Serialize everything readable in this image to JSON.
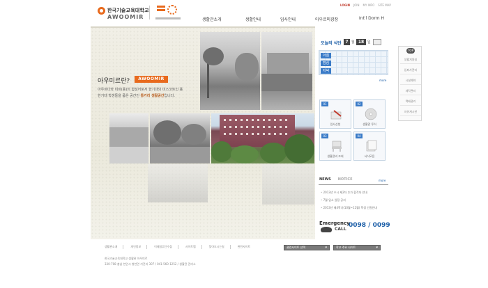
{
  "header": {
    "logo_name": "한국기술교육대학교",
    "logo_sub": "AWOOMIR",
    "top_links": [
      "LOGIN",
      "JOIN",
      "MY INFO",
      "SITE MAP"
    ],
    "gnb": [
      "생활관소개",
      "생활안내",
      "입사안내",
      "아우르미광장",
      "Int'l Dorm H"
    ]
  },
  "hero": {
    "title": "아우미르란?",
    "badge": "AWOOMIR",
    "desc_1": "아우르다와 미르(용)의 합성어로서 한기대의 미스코트인 용",
    "desc_2": "한기대 학생들을 품은 공간인 ",
    "desc_highlight": "통가리 생활공간",
    "desc_3": "입니다."
  },
  "today_meal": {
    "label": "오늘의 식단",
    "month": "7",
    "month_unit": "월",
    "day": "18",
    "day_unit": "일",
    "meals": [
      "아침",
      "점심",
      "저녁"
    ],
    "more": "more"
  },
  "quick_menu": [
    {
      "num": "01",
      "label": "입사신청"
    },
    {
      "num": "02",
      "label": "생활관 투어"
    },
    {
      "num": "03",
      "label": "생활관비 조회"
    },
    {
      "num": "04",
      "label": "서식모음"
    }
  ],
  "news": {
    "tab_news": "NEWS",
    "tab_notice": "NOTICE",
    "more": "more",
    "items": [
      "2013년 수시 제2차 추가 합격자 안내",
      "7월 입소 일정 공지",
      "2013년 제4학기(10월~12월) 학생 인원안내"
    ]
  },
  "emergency": {
    "label": "Emergency",
    "call": "CALL",
    "number": "0098 / 0099"
  },
  "sidebar": {
    "top": "TOP",
    "items": [
      "생활지원실",
      "입퇴사관리",
      "시설예약",
      "세탁관리",
      "택배관리",
      "자유게시판"
    ]
  },
  "footer": {
    "links": [
      "생활관소개",
      "개인정보",
      "이메일무단수집",
      "사이트맵",
      "찾아오시는길",
      "관련사이트"
    ],
    "select_1": "관련사이트 선택",
    "select_2": "학교 주요 사이트",
    "address_1": "한국기술교육대학교 생활관 아우미르",
    "address_2": "330-708 충남 천안시 병천면 가전리 307 / 041-560-1252 / 생활관 관리소"
  },
  "colors": {
    "accent": "#e86a1d",
    "blue": "#3a7bc8",
    "emergency_number": "#1d5fa8"
  }
}
